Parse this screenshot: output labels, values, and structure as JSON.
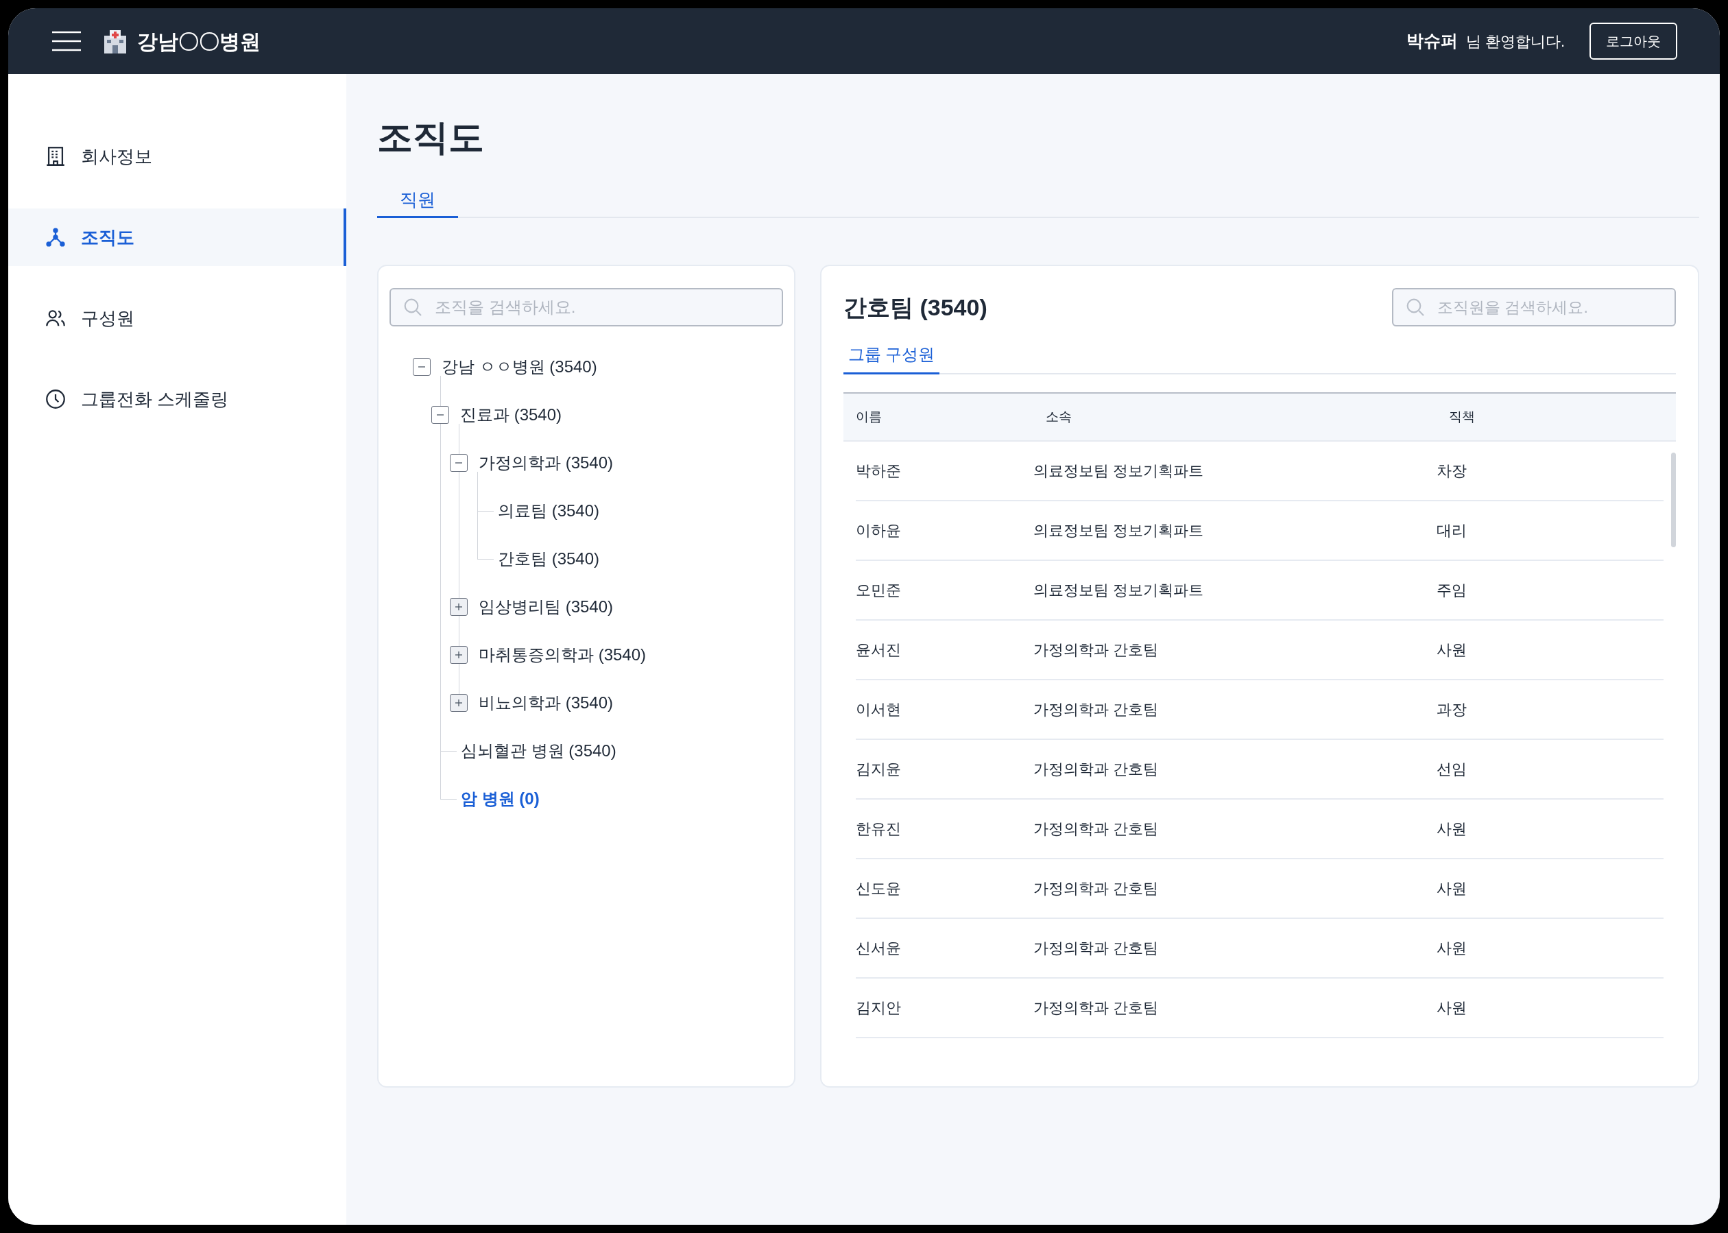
{
  "header": {
    "brand": "강남〇〇병원",
    "user_name": "박슈퍼",
    "greeting": "님 환영합니다.",
    "logout": "로그아웃"
  },
  "sidebar": {
    "items": [
      {
        "label": "회사정보",
        "selected": false
      },
      {
        "label": "조직도",
        "selected": true
      },
      {
        "label": "구성원",
        "selected": false
      },
      {
        "label": "그룹전화 스케줄링",
        "selected": false
      }
    ]
  },
  "page": {
    "title": "조직도",
    "tabs": [
      {
        "label": "직원",
        "selected": true
      }
    ]
  },
  "tree_panel": {
    "search": {
      "placeholder": "조직을 검색하세요."
    },
    "tree": [
      {
        "kind": "branch",
        "label": "강남 ㅇㅇ병원  (3540)",
        "expanded": true,
        "selected": false,
        "children": [
          {
            "kind": "branch",
            "label": "진료과 (3540)",
            "expanded": true,
            "selected": false,
            "children": [
              {
                "kind": "branch",
                "label": "가정의학과 (3540)",
                "expanded": true,
                "selected": false,
                "children": [
                  {
                    "kind": "leaf",
                    "label": "의료팀 (3540)",
                    "selected": false
                  },
                  {
                    "kind": "leaf",
                    "label": "간호팀 (3540)",
                    "selected": false
                  }
                ]
              },
              {
                "kind": "branch",
                "label": "임상병리팀 (3540)",
                "expanded": false,
                "selected": false
              },
              {
                "kind": "branch",
                "label": "마취통증의학과 (3540)",
                "expanded": false,
                "selected": false
              },
              {
                "kind": "branch",
                "label": "비뇨의학과 (3540)",
                "expanded": false,
                "selected": false
              }
            ]
          },
          {
            "kind": "leaf",
            "label": "심뇌혈관 병원 (3540)",
            "selected": false
          },
          {
            "kind": "leaf",
            "label": "암 병원 (0)",
            "selected": true
          }
        ]
      }
    ]
  },
  "member_panel": {
    "title": "간호팀 (3540)",
    "search": {
      "placeholder": "조직원을 검색하세요."
    },
    "tabs": [
      {
        "label": "그룹 구성원",
        "selected": true
      }
    ],
    "table": {
      "columns": [
        "이름",
        "소속",
        "직책"
      ],
      "rows": [
        [
          "박하준",
          "의료정보팀 정보기획파트",
          "차장"
        ],
        [
          "이하윤",
          "의료정보팀 정보기획파트",
          "대리"
        ],
        [
          "오민준",
          "의료정보팀 정보기획파트",
          "주임"
        ],
        [
          "윤서진",
          "가정의학과 간호팀",
          "사원"
        ],
        [
          "이서현",
          "가정의학과 간호팀",
          "과장"
        ],
        [
          "김지윤",
          "가정의학과 간호팀",
          "선임"
        ],
        [
          "한유진",
          "가정의학과 간호팀",
          "사원"
        ],
        [
          "신도윤",
          "가정의학과 간호팀",
          "사원"
        ],
        [
          "신서윤",
          "가정의학과 간호팀",
          "사원"
        ],
        [
          "김지안",
          "가정의학과 간호팀",
          "사원"
        ]
      ]
    }
  }
}
